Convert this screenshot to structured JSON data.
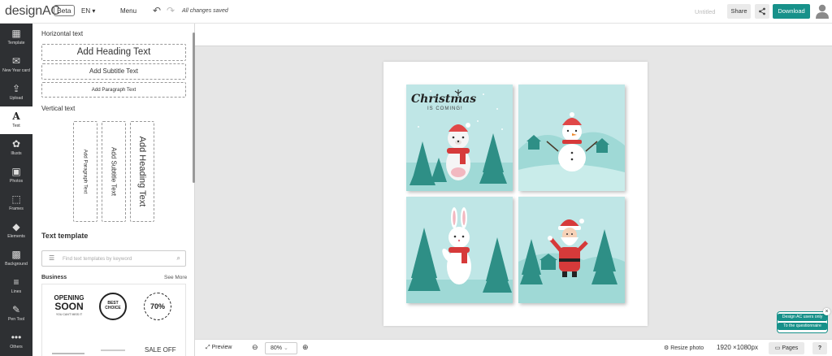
{
  "app": {
    "logo": "designAC",
    "beta_badge": "Beta",
    "language": "EN",
    "menu_label": "Menu",
    "autosave_status": "All changes saved",
    "document_title": "Untitled",
    "share_label": "Share",
    "download_label": "Download",
    "accent_color": "#17918a"
  },
  "rail": {
    "items": [
      {
        "label": "Template",
        "icon": "template-icon"
      },
      {
        "label": "New Year card",
        "icon": "card-icon"
      },
      {
        "label": "Upload",
        "icon": "upload-icon"
      },
      {
        "label": "Text",
        "icon": "text-icon",
        "active": true
      },
      {
        "label": "Illusts",
        "icon": "illust-icon"
      },
      {
        "label": "Photos",
        "icon": "photo-icon"
      },
      {
        "label": "Frames",
        "icon": "frame-icon"
      },
      {
        "label": "Elements",
        "icon": "elements-icon"
      },
      {
        "label": "Background",
        "icon": "background-icon"
      },
      {
        "label": "Lines",
        "icon": "lines-icon"
      },
      {
        "label": "Pen Tool",
        "icon": "pen-icon"
      },
      {
        "label": "Others",
        "icon": "more-icon"
      }
    ]
  },
  "panel": {
    "horizontal_title": "Horizontal text",
    "add_heading": "Add Heading Text",
    "add_subtitle": "Add Subtitle Text",
    "add_paragraph": "Add Paragraph Text",
    "vertical_title": "Vertical text",
    "v_paragraph": "Add Paragraph Text",
    "v_subtitle": "Add Subtitle Text",
    "v_heading": "Add Heading Text",
    "template_title": "Text template",
    "search_placeholder": "Find text templates by keyword",
    "category": "Business",
    "see_more": "See More",
    "templates": {
      "t1_line1": "OPENING",
      "t1_line2": "SOON",
      "t1_line3": "YOU CAN'T MISS IT",
      "t2_line1": "BEST",
      "t2_line2": "CHOICE",
      "t3_text": "70%",
      "t6_text": "SALE OFF"
    }
  },
  "canvas": {
    "card1_title": "Christmas",
    "card1_sub": "IS COMING!",
    "bg_color": "#bfe6e6"
  },
  "bottom": {
    "preview_label": "Preview",
    "zoom": "80%",
    "resize_label": "Resize photo",
    "dimensions": "1920 ×1080px",
    "pages_label": "Pages",
    "help_label": "?"
  },
  "promo": {
    "line1": "Design AC users only",
    "line2": "To the questionnaire"
  }
}
